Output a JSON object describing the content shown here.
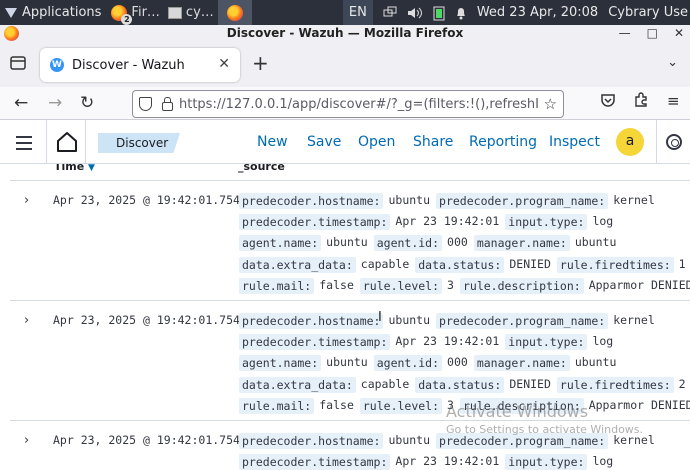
{
  "panel": {
    "applications": "Applications",
    "task_firefox": "Fir…",
    "task_terminal": "cy…",
    "firefox_count": "2",
    "lang": "EN",
    "clock": "Wed 23 Apr, 20:08",
    "user": "Cybrary Use"
  },
  "window": {
    "title": "Discover - Wazuh — Mozilla Firefox"
  },
  "browser": {
    "tab_title": "Discover - Wazuh",
    "url": "https://127.0.0.1/app/discover#/?_g=(filters:!(),refreshI"
  },
  "wazuh": {
    "breadcrumb": "Discover",
    "menu": [
      "New",
      "Save",
      "Open",
      "Share",
      "Reporting",
      "Inspect"
    ],
    "avatar_letter": "a"
  },
  "table": {
    "col_time": "Time",
    "col_source": "_source",
    "rows": [
      {
        "time": "Apr 23, 2025 @ 19:42:01.754",
        "lines": [
          [
            [
              "predecoder.hostname:",
              "ubuntu"
            ],
            [
              "predecoder.program_name:",
              "kernel"
            ]
          ],
          [
            [
              "predecoder.timestamp:",
              "Apr 23 19:42:01"
            ],
            [
              "input.type:",
              "log"
            ]
          ],
          [
            [
              "agent.name:",
              "ubuntu"
            ],
            [
              "agent.id:",
              "000"
            ],
            [
              "manager.name:",
              "ubuntu"
            ]
          ],
          [
            [
              "data.extra_data:",
              "capable"
            ],
            [
              "data.status:",
              "DENIED"
            ],
            [
              "rule.firedtimes:",
              "1"
            ]
          ],
          [
            [
              "rule.mail:",
              "false"
            ],
            [
              "rule.level:",
              "3"
            ],
            [
              "rule.description:",
              "Apparmor DENIED"
            ]
          ]
        ]
      },
      {
        "time": "Apr 23, 2025 @ 19:42:01.754",
        "lines": [
          [
            [
              "predecoder.hostname:",
              "ubuntu"
            ],
            [
              "predecoder.program_name:",
              "kernel"
            ]
          ],
          [
            [
              "predecoder.timestamp:",
              "Apr 23 19:42:01"
            ],
            [
              "input.type:",
              "log"
            ]
          ],
          [
            [
              "agent.name:",
              "ubuntu"
            ],
            [
              "agent.id:",
              "000"
            ],
            [
              "manager.name:",
              "ubuntu"
            ]
          ],
          [
            [
              "data.extra_data:",
              "capable"
            ],
            [
              "data.status:",
              "DENIED"
            ],
            [
              "rule.firedtimes:",
              "2"
            ]
          ],
          [
            [
              "rule.mail:",
              "false"
            ],
            [
              "rule.level:",
              "3"
            ],
            [
              "rule.description:",
              "Apparmor DENIED"
            ]
          ]
        ]
      },
      {
        "time": "Apr 23, 2025 @ 19:42:01.754",
        "lines": [
          [
            [
              "predecoder.hostname:",
              "ubuntu"
            ],
            [
              "predecoder.program_name:",
              "kernel"
            ]
          ],
          [
            [
              "predecoder.timestamp:",
              "Apr 23 19:42:01"
            ],
            [
              "input.type:",
              "log"
            ]
          ]
        ]
      }
    ]
  },
  "watermark": {
    "line1": "Activate Windows",
    "line2": "Go to Settings to activate Windows."
  }
}
